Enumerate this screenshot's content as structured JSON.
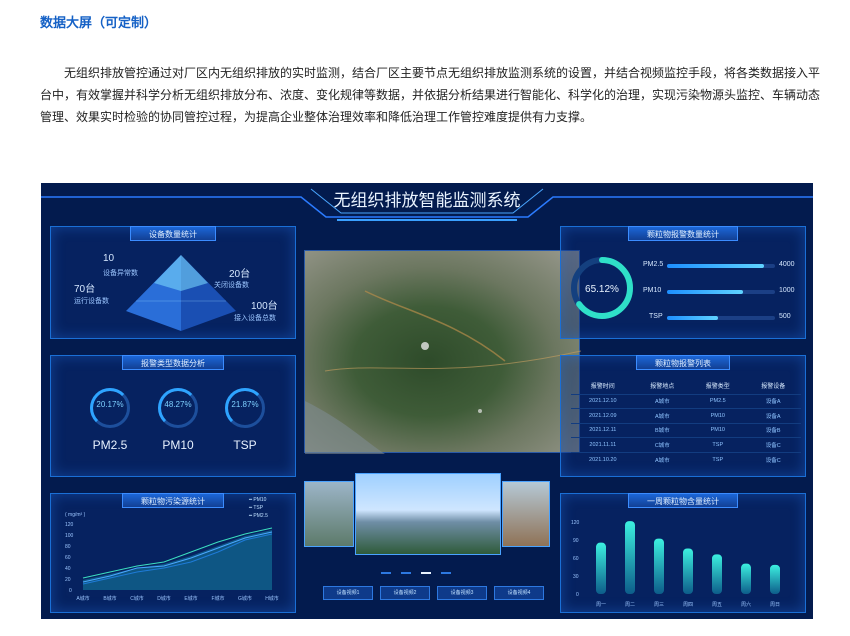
{
  "page": {
    "heading": "数据大屏（可定制）",
    "paragraph": "无组织排放管控通过对厂区内无组织排放的实时监测，结合厂区主要节点无组织排放监测系统的设置，并结合视频监控手段，将各类数据接入平台中，有效掌握并科学分析无组织排放分布、浓度、变化规律等数据，并依据分析结果进行智能化、科学化的治理，实现污染物源头监控、车辆动态管理、效果实时检验的协同管控过程，为提高企业整体治理效率和降低治理工作管控难度提供有力支撑。"
  },
  "dashboard": {
    "title": "无组织排放智能监测系统",
    "device_stats": {
      "title": "设备数量统计",
      "items": [
        {
          "value": "10",
          "label": "设备异常数"
        },
        {
          "value": "20台",
          "label": "关闭设备数"
        },
        {
          "value": "70台",
          "label": "运行设备数"
        },
        {
          "value": "100台",
          "label": "接入设备总数"
        }
      ]
    },
    "alarm_type": {
      "title": "报警类型数据分析",
      "gauges": [
        {
          "value": "20.17%",
          "name": "PM2.5",
          "percent": 20.17
        },
        {
          "value": "48.27%",
          "name": "PM10",
          "percent": 48.27
        },
        {
          "value": "21.87%",
          "name": "TSP",
          "percent": 21.87
        }
      ]
    },
    "pollution_source": {
      "title": "颗粒物污染源统计",
      "unit": "( mg/m³ )",
      "legend": [
        "PM10",
        "TSP",
        "PM2.5"
      ],
      "x_labels": [
        "A城市",
        "B城市",
        "C城市",
        "D城市",
        "E城市",
        "F城市",
        "G城市",
        "H城市"
      ],
      "y_ticks": [
        "120",
        "100",
        "80",
        "60",
        "40",
        "20",
        "0"
      ]
    },
    "particle_alarm_count": {
      "title": "颗粒物报警数量统计",
      "ring_value": "65.12%",
      "ring_percent": 65.12,
      "bars": [
        {
          "name": "PM2.5",
          "value": "4000",
          "fraction": 0.9
        },
        {
          "name": "PM10",
          "value": "1000",
          "fraction": 0.7
        },
        {
          "name": "TSP",
          "value": "500",
          "fraction": 0.47
        }
      ]
    },
    "alarm_list": {
      "title": "颗粒物报警列表",
      "headers": [
        "报警时间",
        "报警地点",
        "报警类型",
        "报警设备"
      ],
      "rows": [
        [
          "2021.12.10",
          "A城市",
          "PM2.5",
          "设备A"
        ],
        [
          "2021.12.09",
          "A城市",
          "PM10",
          "设备A"
        ],
        [
          "2021.12.11",
          "B城市",
          "PM10",
          "设备B"
        ],
        [
          "2021.11.11",
          "C城市",
          "TSP",
          "设备C"
        ],
        [
          "2021.10.20",
          "A城市",
          "TSP",
          "设备C"
        ]
      ]
    },
    "weekly": {
      "title": "一周颗粒物含量统计",
      "y_ticks": [
        "120",
        "90",
        "60",
        "30",
        "0"
      ],
      "days": [
        "周一",
        "周二",
        "周三",
        "周四",
        "周五",
        "周六",
        "周日"
      ],
      "values": [
        88,
        125,
        95,
        78,
        68,
        52,
        50
      ]
    },
    "buttons": [
      "设备视频1",
      "设备视频2",
      "设备视频3",
      "设备视频4"
    ]
  }
}
